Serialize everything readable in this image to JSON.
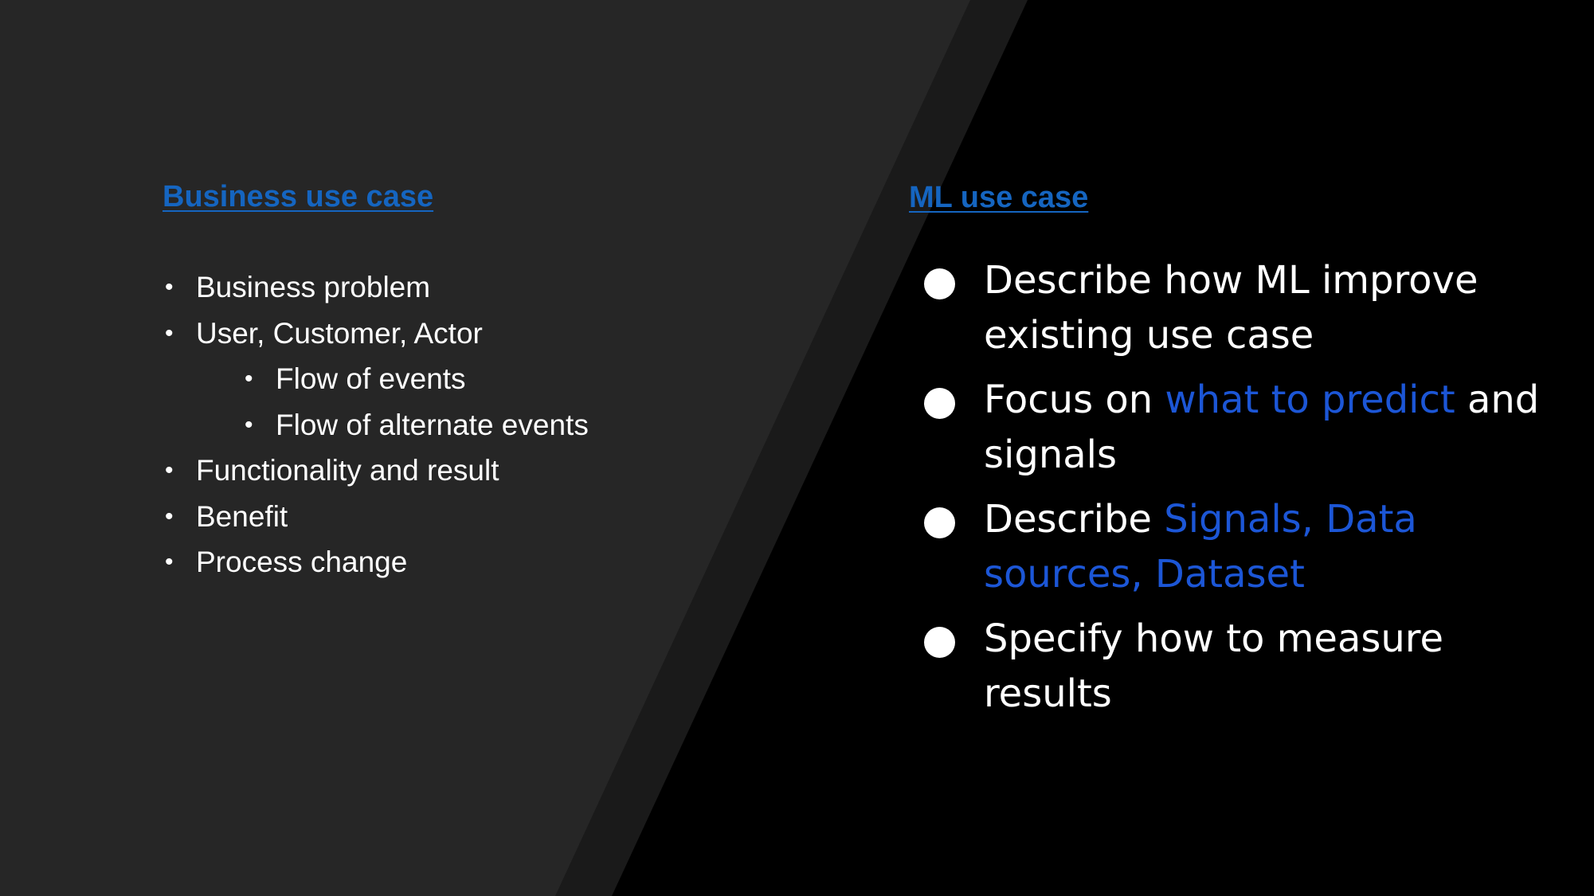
{
  "colors": {
    "left_panel": "#262626",
    "middle_band": "#1a1a1a",
    "right_panel": "#000000",
    "heading_link": "#1565c0",
    "highlight": "#1c56d6",
    "text": "#ffffff"
  },
  "left": {
    "heading": "Business use case",
    "items": [
      {
        "text": "Business problem",
        "level": 1
      },
      {
        "text": "User, Customer, Actor",
        "level": 1
      },
      {
        "text": "Flow of events",
        "level": 2
      },
      {
        "text": "Flow of alternate events",
        "level": 2
      },
      {
        "text": "Functionality and result",
        "level": 1
      },
      {
        "text": "Benefit",
        "level": 1
      },
      {
        "text": "Process change",
        "level": 1
      }
    ]
  },
  "right": {
    "heading": "ML use case",
    "items": [
      {
        "segments": [
          {
            "text": "Describe how ML improve existing use case",
            "highlight": false
          }
        ]
      },
      {
        "segments": [
          {
            "text": "Focus on ",
            "highlight": false
          },
          {
            "text": "what to predict",
            "highlight": true
          },
          {
            "text": " and signals",
            "highlight": false
          }
        ]
      },
      {
        "segments": [
          {
            "text": "Describe ",
            "highlight": false
          },
          {
            "text": "Signals, Data sources, Dataset",
            "highlight": true
          }
        ]
      },
      {
        "segments": [
          {
            "text": "Specify how to measure results",
            "highlight": false
          }
        ]
      }
    ]
  }
}
